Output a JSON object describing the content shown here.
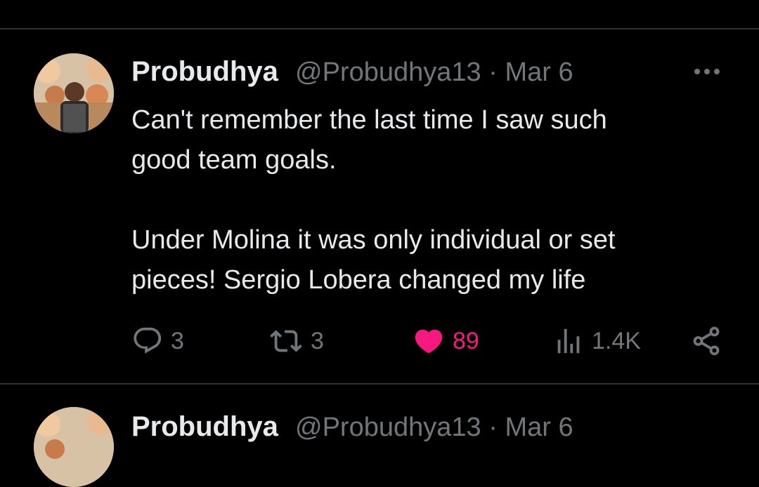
{
  "tweet": {
    "author_name": "Probudhya",
    "author_handle": "@Probudhya13",
    "separator": "·",
    "date": "Mar 6",
    "text_lines": [
      "Can't remember the last time I saw such",
      "good team goals.",
      "Under Molina it  was only individual or set",
      "pieces! Sergio Lobera changed my life"
    ],
    "actions": {
      "replies": "3",
      "retweets": "3",
      "likes": "89",
      "views": "1.4K"
    }
  },
  "next_tweet": {
    "author_name": "Probudhya",
    "author_handle": "@Probudhya13",
    "separator": "·",
    "date": "Mar 6"
  },
  "colors": {
    "background": "#000000",
    "text": "#e7e9ea",
    "secondary": "#71767b",
    "like": "#f91880",
    "divider": "#2f3336"
  },
  "icons": [
    "more-icon",
    "reply-icon",
    "retweet-icon",
    "like-icon",
    "views-icon",
    "share-icon"
  ]
}
